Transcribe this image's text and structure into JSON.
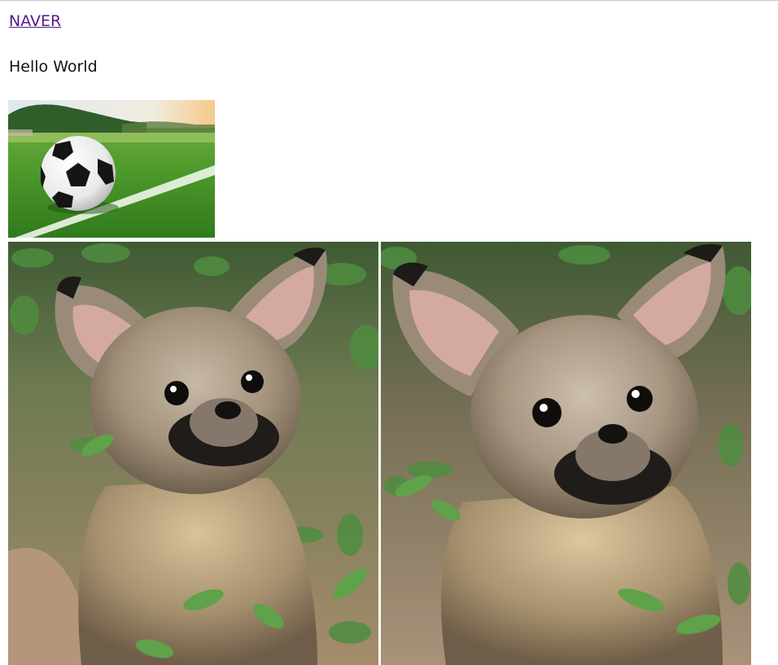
{
  "link": {
    "label": "NAVER"
  },
  "heading": {
    "text": "Hello World"
  },
  "images": [
    {
      "name": "soccer-ball-image",
      "subject": "soccer ball on grass field"
    },
    {
      "name": "fennec-fox-image-1",
      "subject": "baby fennec fox among leaves"
    },
    {
      "name": "fennec-fox-image-2",
      "subject": "baby fennec fox among leaves"
    }
  ],
  "colors": {
    "link": "#551a8b",
    "text": "#111111",
    "background": "#ffffff"
  }
}
